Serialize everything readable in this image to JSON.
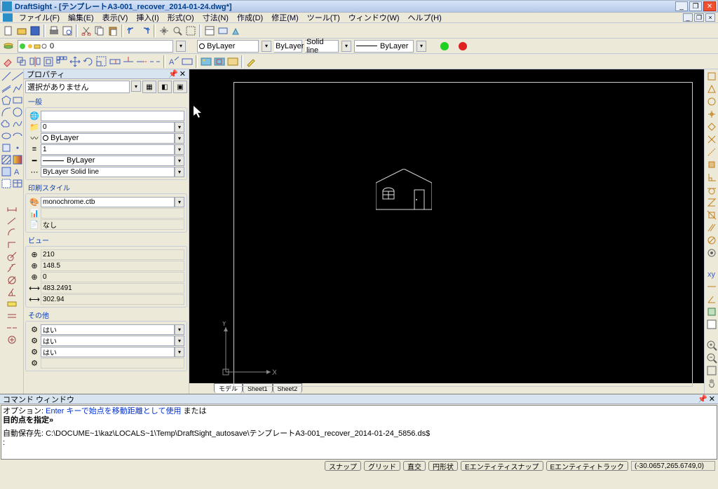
{
  "title": "DraftSight - [テンプレートA3-001_recover_2014-01-24.dwg*]",
  "menus": [
    "ファイル(F)",
    "編集(E)",
    "表示(V)",
    "挿入(I)",
    "形式(O)",
    "寸法(N)",
    "作成(D)",
    "修正(M)",
    "ツール(T)",
    "ウィンドウ(W)",
    "ヘルプ(H)"
  ],
  "layer_combo": "0",
  "color_bylayer": "ByLayer",
  "linetype_bylayer": "ByLayer",
  "solid_line": "Solid line",
  "line_bylayer": "ByLayer",
  "props": {
    "title": "プロパティ",
    "selection_none": "選択がありません",
    "grp_general": "一般",
    "general": {
      "color": "",
      "layer": "0",
      "bylayer": "ByLayer",
      "scale": "1",
      "ltype": "ByLayer",
      "lstyle": "ByLayer   Solid line"
    },
    "grp_print": "印刷スタイル",
    "print": {
      "ctb": "monochrome.ctb",
      "none": "なし"
    },
    "grp_view": "ビュー",
    "view": {
      "v1": "210",
      "v2": "148.5",
      "v3": "0",
      "v4": "483.2491",
      "v5": "302.94"
    },
    "grp_other": "その他",
    "other": {
      "o1": "はい",
      "o2": "はい",
      "o3": "はい"
    }
  },
  "tabs": {
    "model": "モデル",
    "sheet1": "Sheet1",
    "sheet2": "Sheet2"
  },
  "cmd": {
    "title": "コマンド ウィンドウ",
    "line1a": "オプション: ",
    "line1b": "Enter キーで始点を移動距離として使用",
    "line1c": " または",
    "line2": "目的点を指定»",
    "line3": "自動保存先: C:\\DOCUME~1\\kaz\\LOCALS~1\\Temp\\DraftSight_autosave\\テンプレートA3-001_recover_2014-01-24_5856.ds$",
    "prompt": ":"
  },
  "status": {
    "buttons": [
      "スナップ",
      "グリッド",
      "直交",
      "円形状",
      "Eエンティティスナップ",
      "Eエンティティトラック"
    ],
    "coords": "(-30.0657,265.6749,0)"
  }
}
